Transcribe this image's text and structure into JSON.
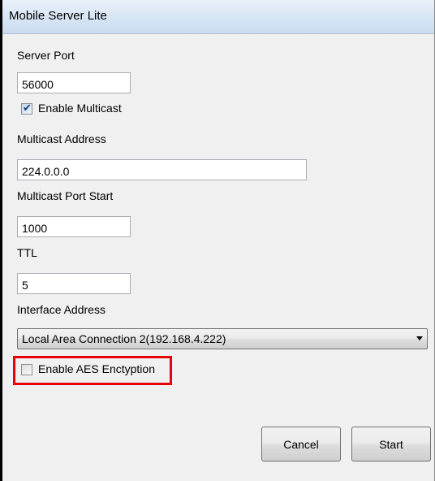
{
  "window": {
    "title": "Mobile Server Lite"
  },
  "server_port": {
    "label": "Server Port",
    "value": "56000"
  },
  "enable_multicast": {
    "label": "Enable Multicast",
    "checked": true
  },
  "multicast_address": {
    "label": "Multicast Address",
    "value": "224.0.0.0"
  },
  "multicast_port_start": {
    "label": "Multicast Port Start",
    "value": "1000"
  },
  "ttl": {
    "label": "TTL",
    "value": "5"
  },
  "interface_address": {
    "label": "Interface Address",
    "selected": "Local Area Connection 2(192.168.4.222)"
  },
  "enable_aes": {
    "label": "Enable AES Enctyption",
    "checked": false
  },
  "buttons": {
    "cancel": "Cancel",
    "start": "Start"
  },
  "colors": {
    "highlight": "#e8000b",
    "window_background": "#f0f0f0",
    "checkmark": "#1c3f73"
  }
}
